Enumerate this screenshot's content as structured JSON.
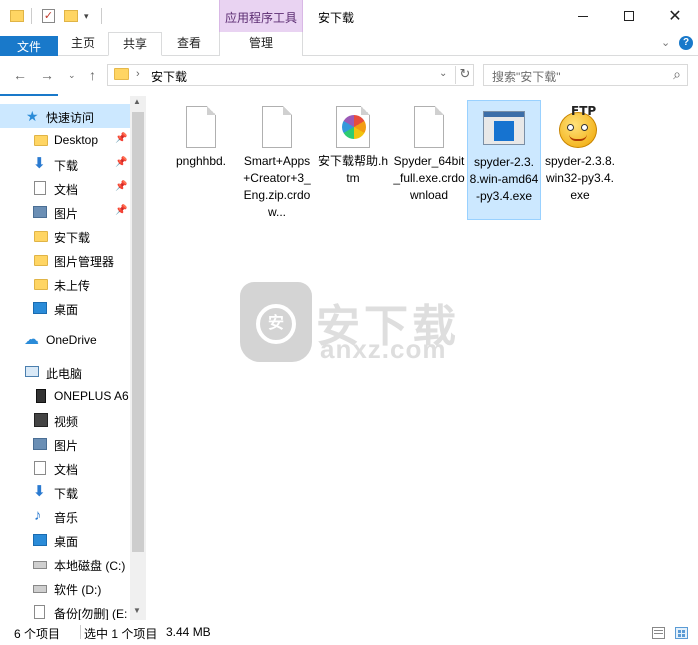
{
  "window": {
    "title": "安下载",
    "context_tab": "应用程序工具"
  },
  "ribbon": {
    "tabs": [
      "文件",
      "主页",
      "共享",
      "查看"
    ],
    "context_subtab": "管理",
    "help": "?"
  },
  "address": {
    "path": "安下载",
    "search_placeholder": "搜索\"安下载\""
  },
  "nav": {
    "quick_access": "快速访问",
    "items": [
      {
        "label": "Desktop",
        "pinned": true
      },
      {
        "label": "下载",
        "pinned": true
      },
      {
        "label": "文档",
        "pinned": true
      },
      {
        "label": "图片",
        "pinned": true
      },
      {
        "label": "安下载",
        "pinned": false
      },
      {
        "label": "图片管理器",
        "pinned": false
      },
      {
        "label": "未上传",
        "pinned": false
      },
      {
        "label": "桌面",
        "pinned": false
      }
    ],
    "onedrive": "OneDrive",
    "this_pc": "此电脑",
    "pc_items": [
      {
        "label": "ONEPLUS A6"
      },
      {
        "label": "视频"
      },
      {
        "label": "图片"
      },
      {
        "label": "文档"
      },
      {
        "label": "下载"
      },
      {
        "label": "音乐"
      },
      {
        "label": "桌面"
      },
      {
        "label": "本地磁盘 (C:)"
      },
      {
        "label": "软件 (D:)"
      },
      {
        "label": "备份[勿删] (E:"
      }
    ]
  },
  "files": [
    {
      "name": "pnghhbd.",
      "icon": "blank-file"
    },
    {
      "name": "Smart+Apps+Creator+3_Eng.zip.crdow...",
      "icon": "blank-file"
    },
    {
      "name": "安下载帮助.htm",
      "icon": "colorful-wheel"
    },
    {
      "name": "Spyder_64bit_full.exe.crdownload",
      "icon": "blank-file"
    },
    {
      "name": "spyder-2.3.8.win-amd64-py3.4.exe",
      "icon": "app-window",
      "selected": true
    },
    {
      "name": "spyder-2.3.8.win32-py3.4.exe",
      "icon": "ftp-smiley"
    }
  ],
  "watermark": {
    "text": "安下载",
    "sub": "anxz.com",
    "shield": "安"
  },
  "status": {
    "count": "6 个项目",
    "selection": "选中 1 个项目",
    "size": "3.44 MB"
  }
}
